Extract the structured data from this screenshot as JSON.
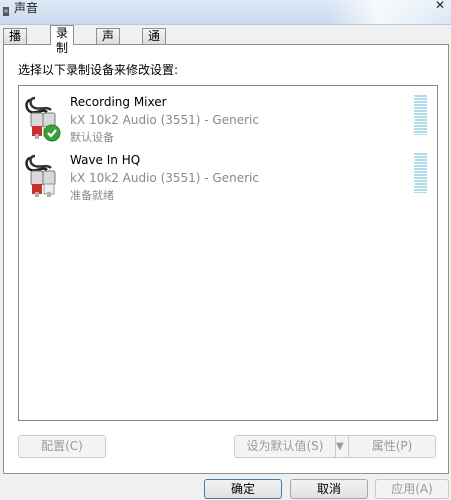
{
  "window": {
    "title": "声音"
  },
  "tabs": [
    {
      "label": "播放"
    },
    {
      "label": "录制"
    },
    {
      "label": "声音"
    },
    {
      "label": "通信"
    }
  ],
  "instruction": "选择以下录制设备来修改设置:",
  "devices": [
    {
      "name": "Recording Mixer",
      "driver": "kX 10k2 Audio (3551) - Generic",
      "status": "默认设备",
      "default": true
    },
    {
      "name": "Wave In HQ",
      "driver": "kX 10k2 Audio (3551) - Generic",
      "status": "准备就绪",
      "default": false
    }
  ],
  "panel_buttons": {
    "configure": "配置(C)",
    "set_default": "设为默认值(S)",
    "properties": "属性(P)"
  },
  "dialog_buttons": {
    "ok": "确定",
    "cancel": "取消",
    "apply": "应用(A)"
  },
  "colors": {
    "meter": "#aedce8",
    "default_check": "#3aa13a"
  }
}
